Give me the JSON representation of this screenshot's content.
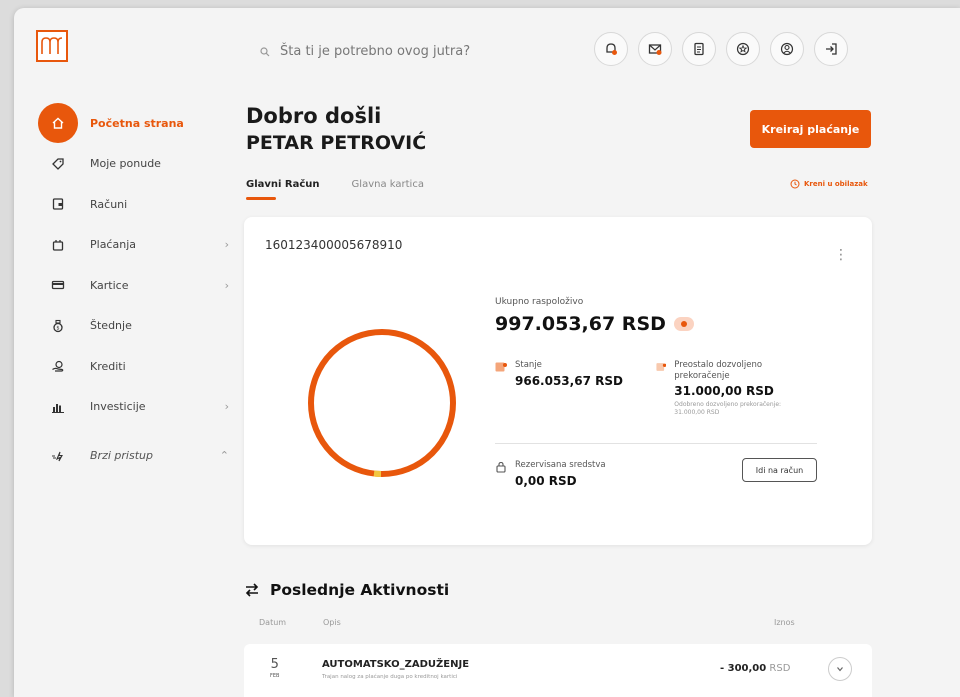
{
  "search": {
    "placeholder": "Šta ti je potrebno ovog jutra?"
  },
  "header_icons": [
    "bell-icon",
    "mail-icon",
    "document-icon",
    "star-badge-icon",
    "user-icon",
    "logout-icon"
  ],
  "sidebar": {
    "items": [
      {
        "label": "Početna strana",
        "icon": "home-icon",
        "active": true
      },
      {
        "label": "Moje ponude",
        "icon": "tag-icon"
      },
      {
        "label": "Računi",
        "icon": "wallet-icon"
      },
      {
        "label": "Plaćanja",
        "icon": "payment-icon",
        "chevron": "›"
      },
      {
        "label": "Kartice",
        "icon": "card-icon",
        "chevron": "›"
      },
      {
        "label": "Štednje",
        "icon": "savings-icon"
      },
      {
        "label": "Krediti",
        "icon": "loan-icon"
      },
      {
        "label": "Investicije",
        "icon": "chart-icon",
        "chevron": "›"
      }
    ],
    "quick": {
      "label": "Brzi pristup",
      "icon": "quick-access-icon",
      "chevron": "⌃"
    }
  },
  "welcome": {
    "line1": "Dobro došli",
    "line2": "PETAR PETROVIĆ"
  },
  "create_button": "Kreiraj plaćanje",
  "tabs": [
    {
      "label": "Glavni Račun",
      "active": true
    },
    {
      "label": "Glavna kartica"
    }
  ],
  "main_link": "Kreni u obilazak",
  "account": {
    "number": "160123400005678910",
    "menu": "⋮",
    "total_label": "Ukupno raspoloživo",
    "total": "997.053,67 RSD",
    "balance_label": "Stanje",
    "balance": "966.053,67 RSD",
    "overdraft_label": "Preostalo dozvoljeno prekoračenje",
    "overdraft": "31.000,00 RSD",
    "overdraft_note": "Odobreno dozvoljeno prekoračenje: 31.000,00 RSD",
    "reserved_label": "Rezervisana sredstva",
    "reserved": "0,00 RSD",
    "go_button": "Idi na račun"
  },
  "activity": {
    "title": "Poslednje Aktivnosti",
    "headers": {
      "date": "Datum",
      "desc": "Opis",
      "amount": "Iznos"
    },
    "rows": [
      {
        "day": "5",
        "month": "FEB",
        "title": "AUTOMATSKO_ZADUŽENJE",
        "subtitle": "Trajan nalog za plaćanje duga po kreditnoj kartici",
        "amount": "- 300,00",
        "currency": "RSD"
      }
    ]
  },
  "colors": {
    "accent": "#e8570c",
    "background": "#f4f4f4",
    "card": "#ffffff"
  }
}
